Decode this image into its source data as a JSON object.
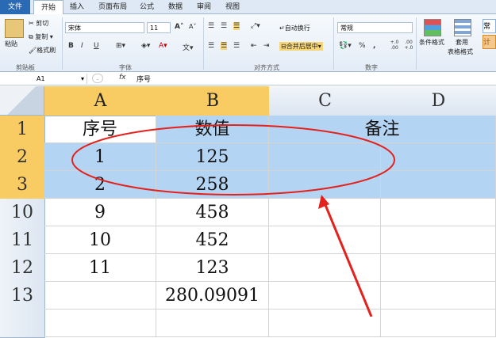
{
  "tabs": [
    "文件",
    "开始",
    "插入",
    "页面布局",
    "公式",
    "数据",
    "审阅",
    "视图"
  ],
  "clipboard": {
    "paste": "粘贴",
    "cut": "剪切",
    "copy": "复制",
    "format_painter": "格式刷",
    "group": "剪贴板"
  },
  "font": {
    "name": "宋体",
    "size": "11",
    "grow": "A",
    "shrink": "A",
    "bold": "B",
    "italic": "I",
    "underline": "U",
    "group": "字体",
    "wen": "文"
  },
  "alignment": {
    "wrap": "自动换行",
    "merge": "合并后居中",
    "group": "对齐方式"
  },
  "number": {
    "format": "常规",
    "percent": "%",
    "comma": ",",
    "group": "数字",
    "inc": "+.0 .00",
    "dec": ".00 +.0"
  },
  "styles": {
    "conditional": "条件格式",
    "table_line1": "套用",
    "table_line2": "表格格式",
    "style_normal": "常",
    "style_calc": "计"
  },
  "formula_bar": {
    "name_box": "A1",
    "fx": "fx",
    "content": "序号"
  },
  "columns": [
    "A",
    "B",
    "C",
    "D"
  ],
  "rows": [
    {
      "num": "1",
      "a": "序号",
      "b": "数值",
      "merged": "备注"
    },
    {
      "num": "2",
      "a": "1",
      "b": "125"
    },
    {
      "num": "3",
      "a": "2",
      "b": "258"
    },
    {
      "num": "10",
      "a": "9",
      "b": "458"
    },
    {
      "num": "11",
      "a": "10",
      "b": "452"
    },
    {
      "num": "12",
      "a": "11",
      "b": "123"
    },
    {
      "num": "13",
      "a": "",
      "b": "280.09091"
    },
    {
      "num": "",
      "a": "",
      "b": ""
    }
  ],
  "colors": {
    "selection": "#b4d4f4",
    "header_active": "#f8cb63",
    "annotation": "#e3221d"
  }
}
